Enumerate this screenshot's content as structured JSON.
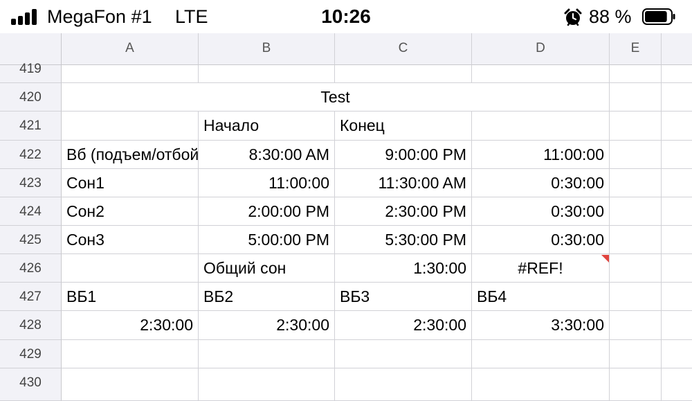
{
  "status_bar": {
    "carrier": "MegaFon #1",
    "network": "LTE",
    "time": "10:26",
    "battery_percent": "88 %",
    "battery_level": 0.88
  },
  "sheet": {
    "columns": [
      "A",
      "B",
      "C",
      "D",
      "E"
    ],
    "rows": [
      "419",
      "420",
      "421",
      "422",
      "423",
      "424",
      "425",
      "426",
      "427",
      "428",
      "429",
      "430"
    ],
    "cells": {
      "r420_title": "Test",
      "r421_b": "Начало",
      "r421_c": "Конец",
      "r422_a": "Вб (подъем/отбой)",
      "r422_b": "8:30:00 AM",
      "r422_c": "9:00:00 PM",
      "r422_d": "11:00:00",
      "r423_a": "Сон1",
      "r423_b": "11:00:00",
      "r423_c": "11:30:00 AM",
      "r423_d": "0:30:00",
      "r424_a": "Сон2",
      "r424_b": "2:00:00 PM",
      "r424_c": "2:30:00 PM",
      "r424_d": "0:30:00",
      "r425_a": "Сон3",
      "r425_b": "5:00:00 PM",
      "r425_c": "5:30:00 PM",
      "r425_d": "0:30:00",
      "r426_b": "Общий сон",
      "r426_c": "1:30:00",
      "r426_d": "#REF!",
      "r427_a": "ВБ1",
      "r427_b": "ВБ2",
      "r427_c": "ВБ3",
      "r427_d": "ВБ4",
      "r428_a": "2:30:00",
      "r428_b": "2:30:00",
      "r428_c": "2:30:00",
      "r428_d": "3:30:00"
    }
  },
  "colors": {
    "header_bg": "#f2f2f7",
    "grid_line": "#d1d1d6",
    "comment_marker": "#e0443e"
  },
  "icons": [
    "signal-icon",
    "alarm-icon",
    "battery-icon"
  ]
}
